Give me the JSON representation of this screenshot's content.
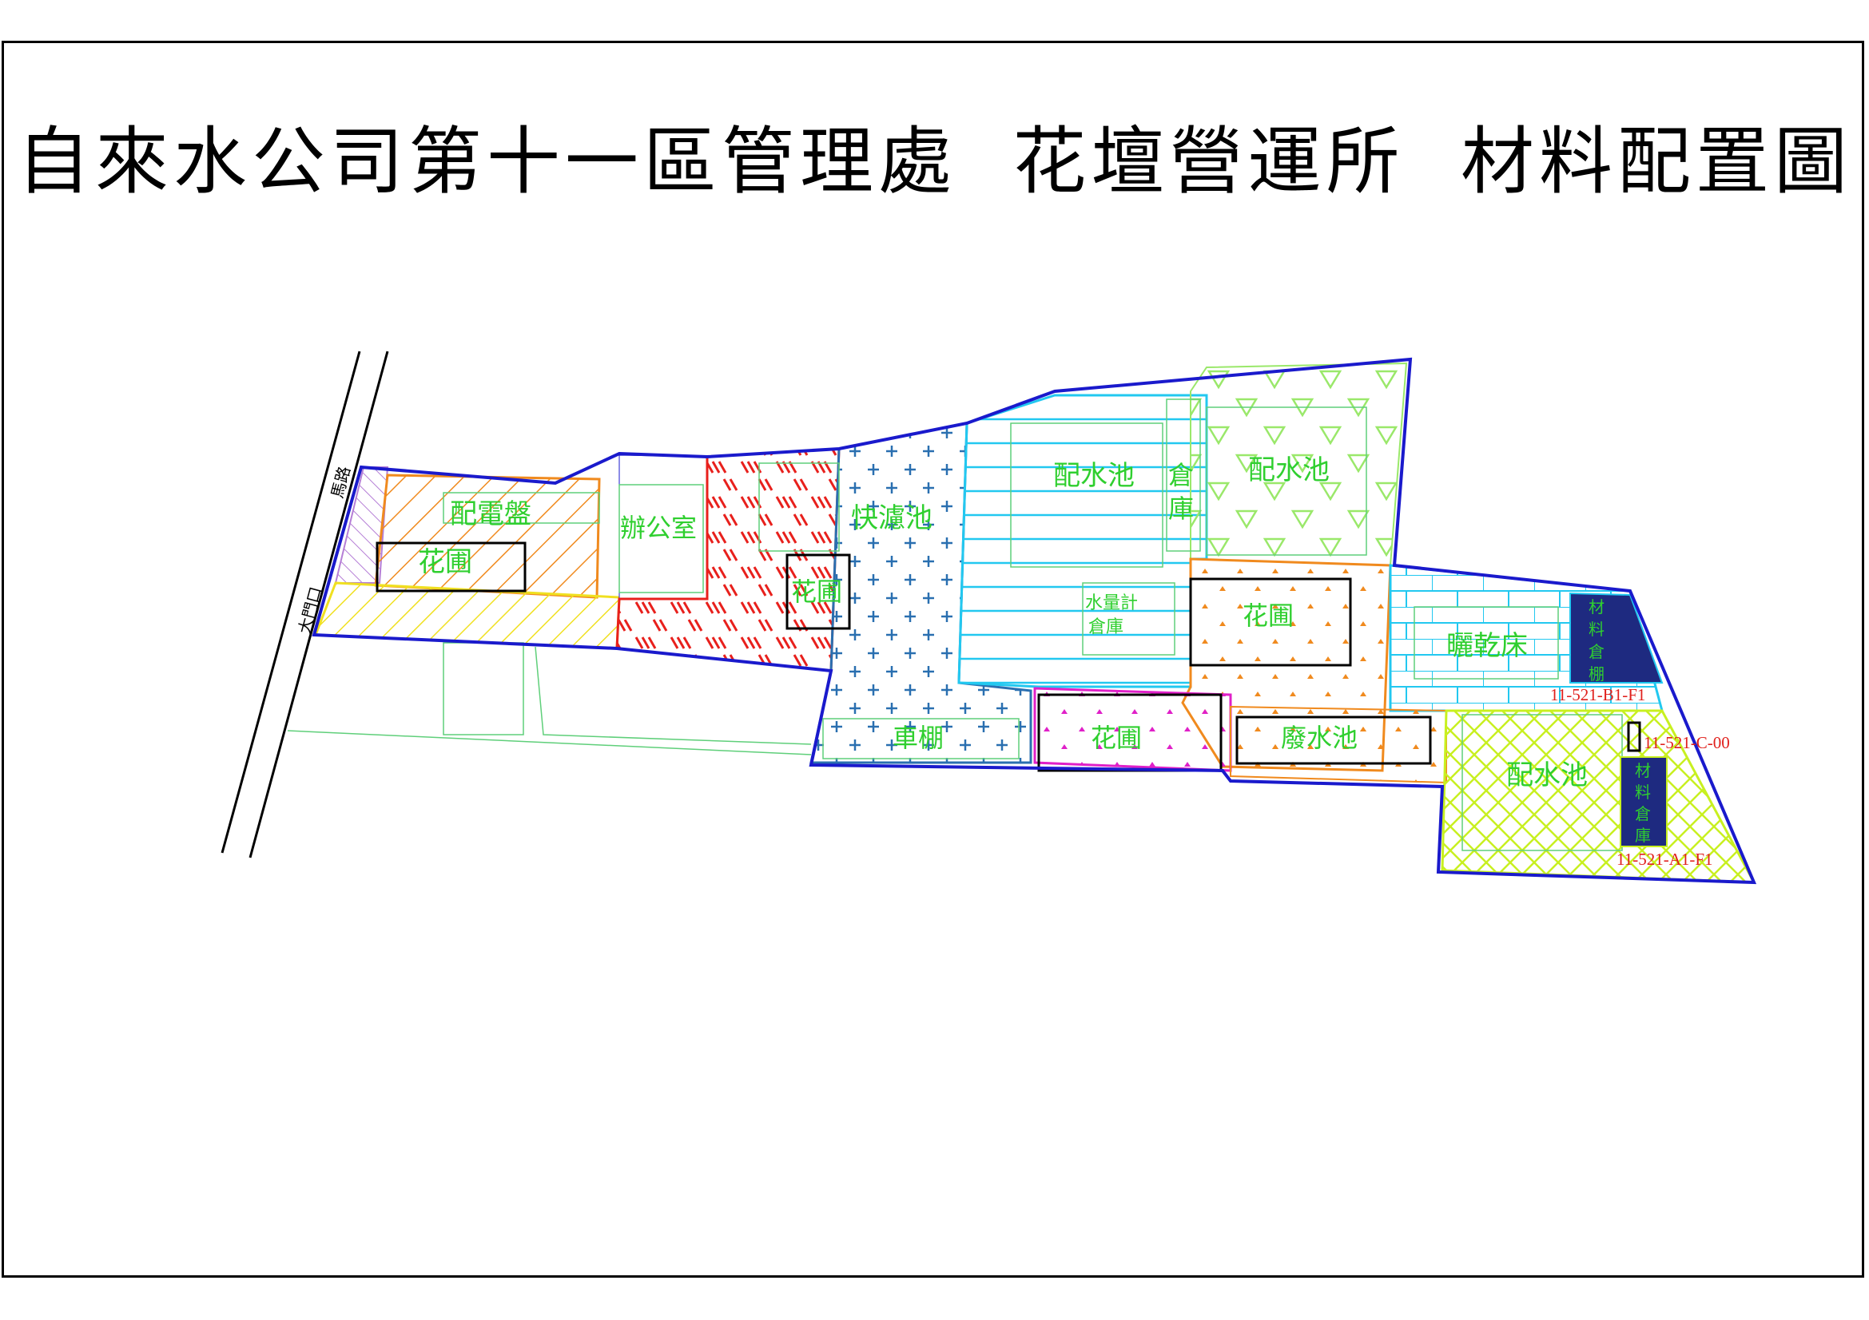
{
  "title": "自來水公司第十一區管理處  花壇營運所  材料配置圖",
  "road_label": "大門口",
  "road_name": "馬路",
  "areas": {
    "power_panel": "配電盤",
    "garden_1": "花圃",
    "office": "辦公室",
    "fast_filter": "快濾池",
    "garden_2": "花圃",
    "reservoir_1": "配水池",
    "warehouse_1_a": "倉",
    "warehouse_1_b": "庫",
    "reservoir_2": "配水池",
    "meter_warehouse_a": "水量計",
    "meter_warehouse_b": "倉庫",
    "garden_3": "花圃",
    "drying_bed": "曬乾床",
    "material_shed": [
      "材",
      "料",
      "倉",
      "棚"
    ],
    "carport": "車棚",
    "garden_4": "花圃",
    "waste_pool": "廢水池",
    "reservoir_3": "配水池",
    "material_warehouse": [
      "材",
      "料",
      "倉",
      "庫"
    ]
  },
  "codes": {
    "shed_code": "11-521-B1-F1",
    "small_code": "11-521-C-00",
    "warehouse_code": "11-521-A1-F1"
  },
  "colors": {
    "label": "#2fcf2f",
    "code": "#e0201c",
    "boundary": "#1a1acc",
    "purple": "#b57ed6",
    "orange": "#f08a1e",
    "yellow": "#f0e020",
    "red": "#e8201c",
    "steel": "#2a6fb0",
    "cyan": "#22c8f0",
    "lightgreen": "#9ae86a",
    "magenta": "#e020c8",
    "lime": "#c8f020",
    "navy": "#1e2a80"
  }
}
